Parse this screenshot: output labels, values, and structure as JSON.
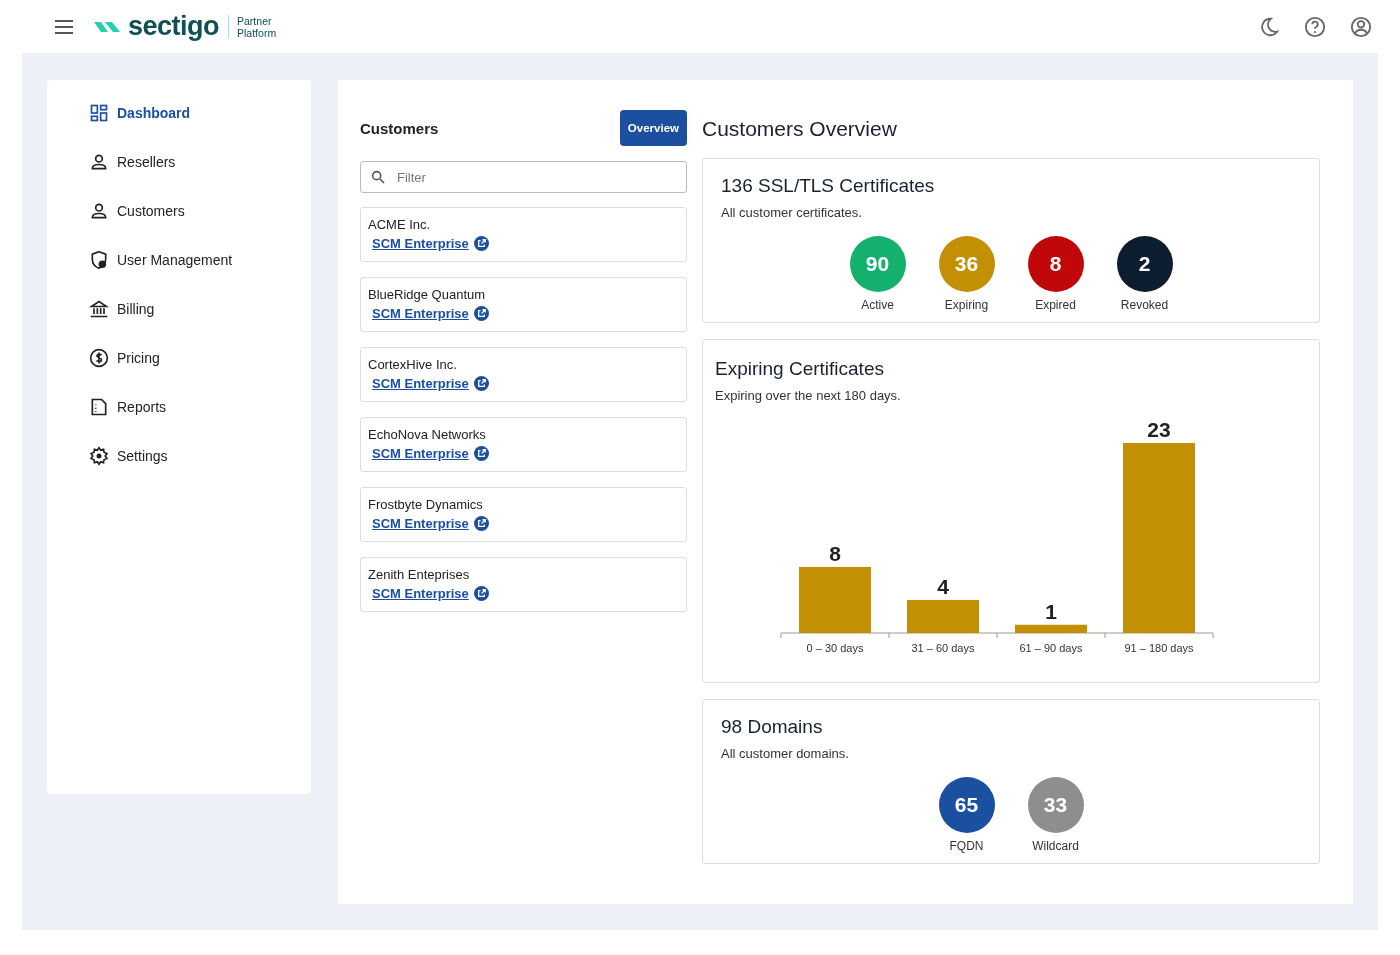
{
  "header": {
    "brand": "sectigo",
    "subtitle_line_1": "Partner",
    "subtitle_line_2": "Platform"
  },
  "sidebar": {
    "items": [
      {
        "label": "Dashboard",
        "selected": true
      },
      {
        "label": "Resellers",
        "selected": false
      },
      {
        "label": "Customers",
        "selected": false
      },
      {
        "label": "User Management",
        "selected": false
      },
      {
        "label": "Billing",
        "selected": false
      },
      {
        "label": "Pricing",
        "selected": false
      },
      {
        "label": "Reports",
        "selected": false
      },
      {
        "label": "Settings",
        "selected": false
      }
    ]
  },
  "customers": {
    "title": "Customers",
    "overview_button": "Overview",
    "filter": {
      "placeholder": "Filter"
    },
    "items": [
      {
        "name": "ACME Inc.",
        "link": "SCM Enterprise"
      },
      {
        "name": "BlueRidge Quantum",
        "link": "SCM Enterprise"
      },
      {
        "name": "CortexHive Inc.",
        "link": "SCM Enterprise"
      },
      {
        "name": "EchoNova Networks",
        "link": "SCM Enterprise"
      },
      {
        "name": "Frostbyte Dynamics",
        "link": "SCM Enterprise"
      },
      {
        "name": "Zenith Enteprises",
        "link": "SCM Enterprise"
      }
    ]
  },
  "overview": {
    "title": "Customers Overview",
    "certificates": {
      "title": "136 SSL/TLS Certificates",
      "subtitle": "All customer certificates.",
      "stats": [
        {
          "value": "90",
          "label": "Active",
          "color": "#14b06e"
        },
        {
          "value": "36",
          "label": "Expiring",
          "color": "#c38f05"
        },
        {
          "value": "8",
          "label": "Expired",
          "color": "#c0080b"
        },
        {
          "value": "2",
          "label": "Revoked",
          "color": "#0b1d2e"
        }
      ]
    },
    "expiring": {
      "title": "Expiring Certificates",
      "subtitle": "Expiring over the next 180 days.",
      "chart_data": {
        "type": "bar",
        "categories": [
          "0 – 30 days",
          "31 – 60 days",
          "61 – 90 days",
          "91 – 180 days"
        ],
        "series": [
          {
            "color": "#c38f05",
            "values": [
              8,
              4,
              1,
              23
            ]
          }
        ],
        "data_labels": true
      }
    },
    "domains": {
      "title": "98 Domains",
      "subtitle": "All customer domains.",
      "stats": [
        {
          "value": "65",
          "label": "FQDN",
          "color": "#1b4fa0"
        },
        {
          "value": "33",
          "label": "Wildcard",
          "color": "#8e8e8e"
        }
      ]
    }
  }
}
